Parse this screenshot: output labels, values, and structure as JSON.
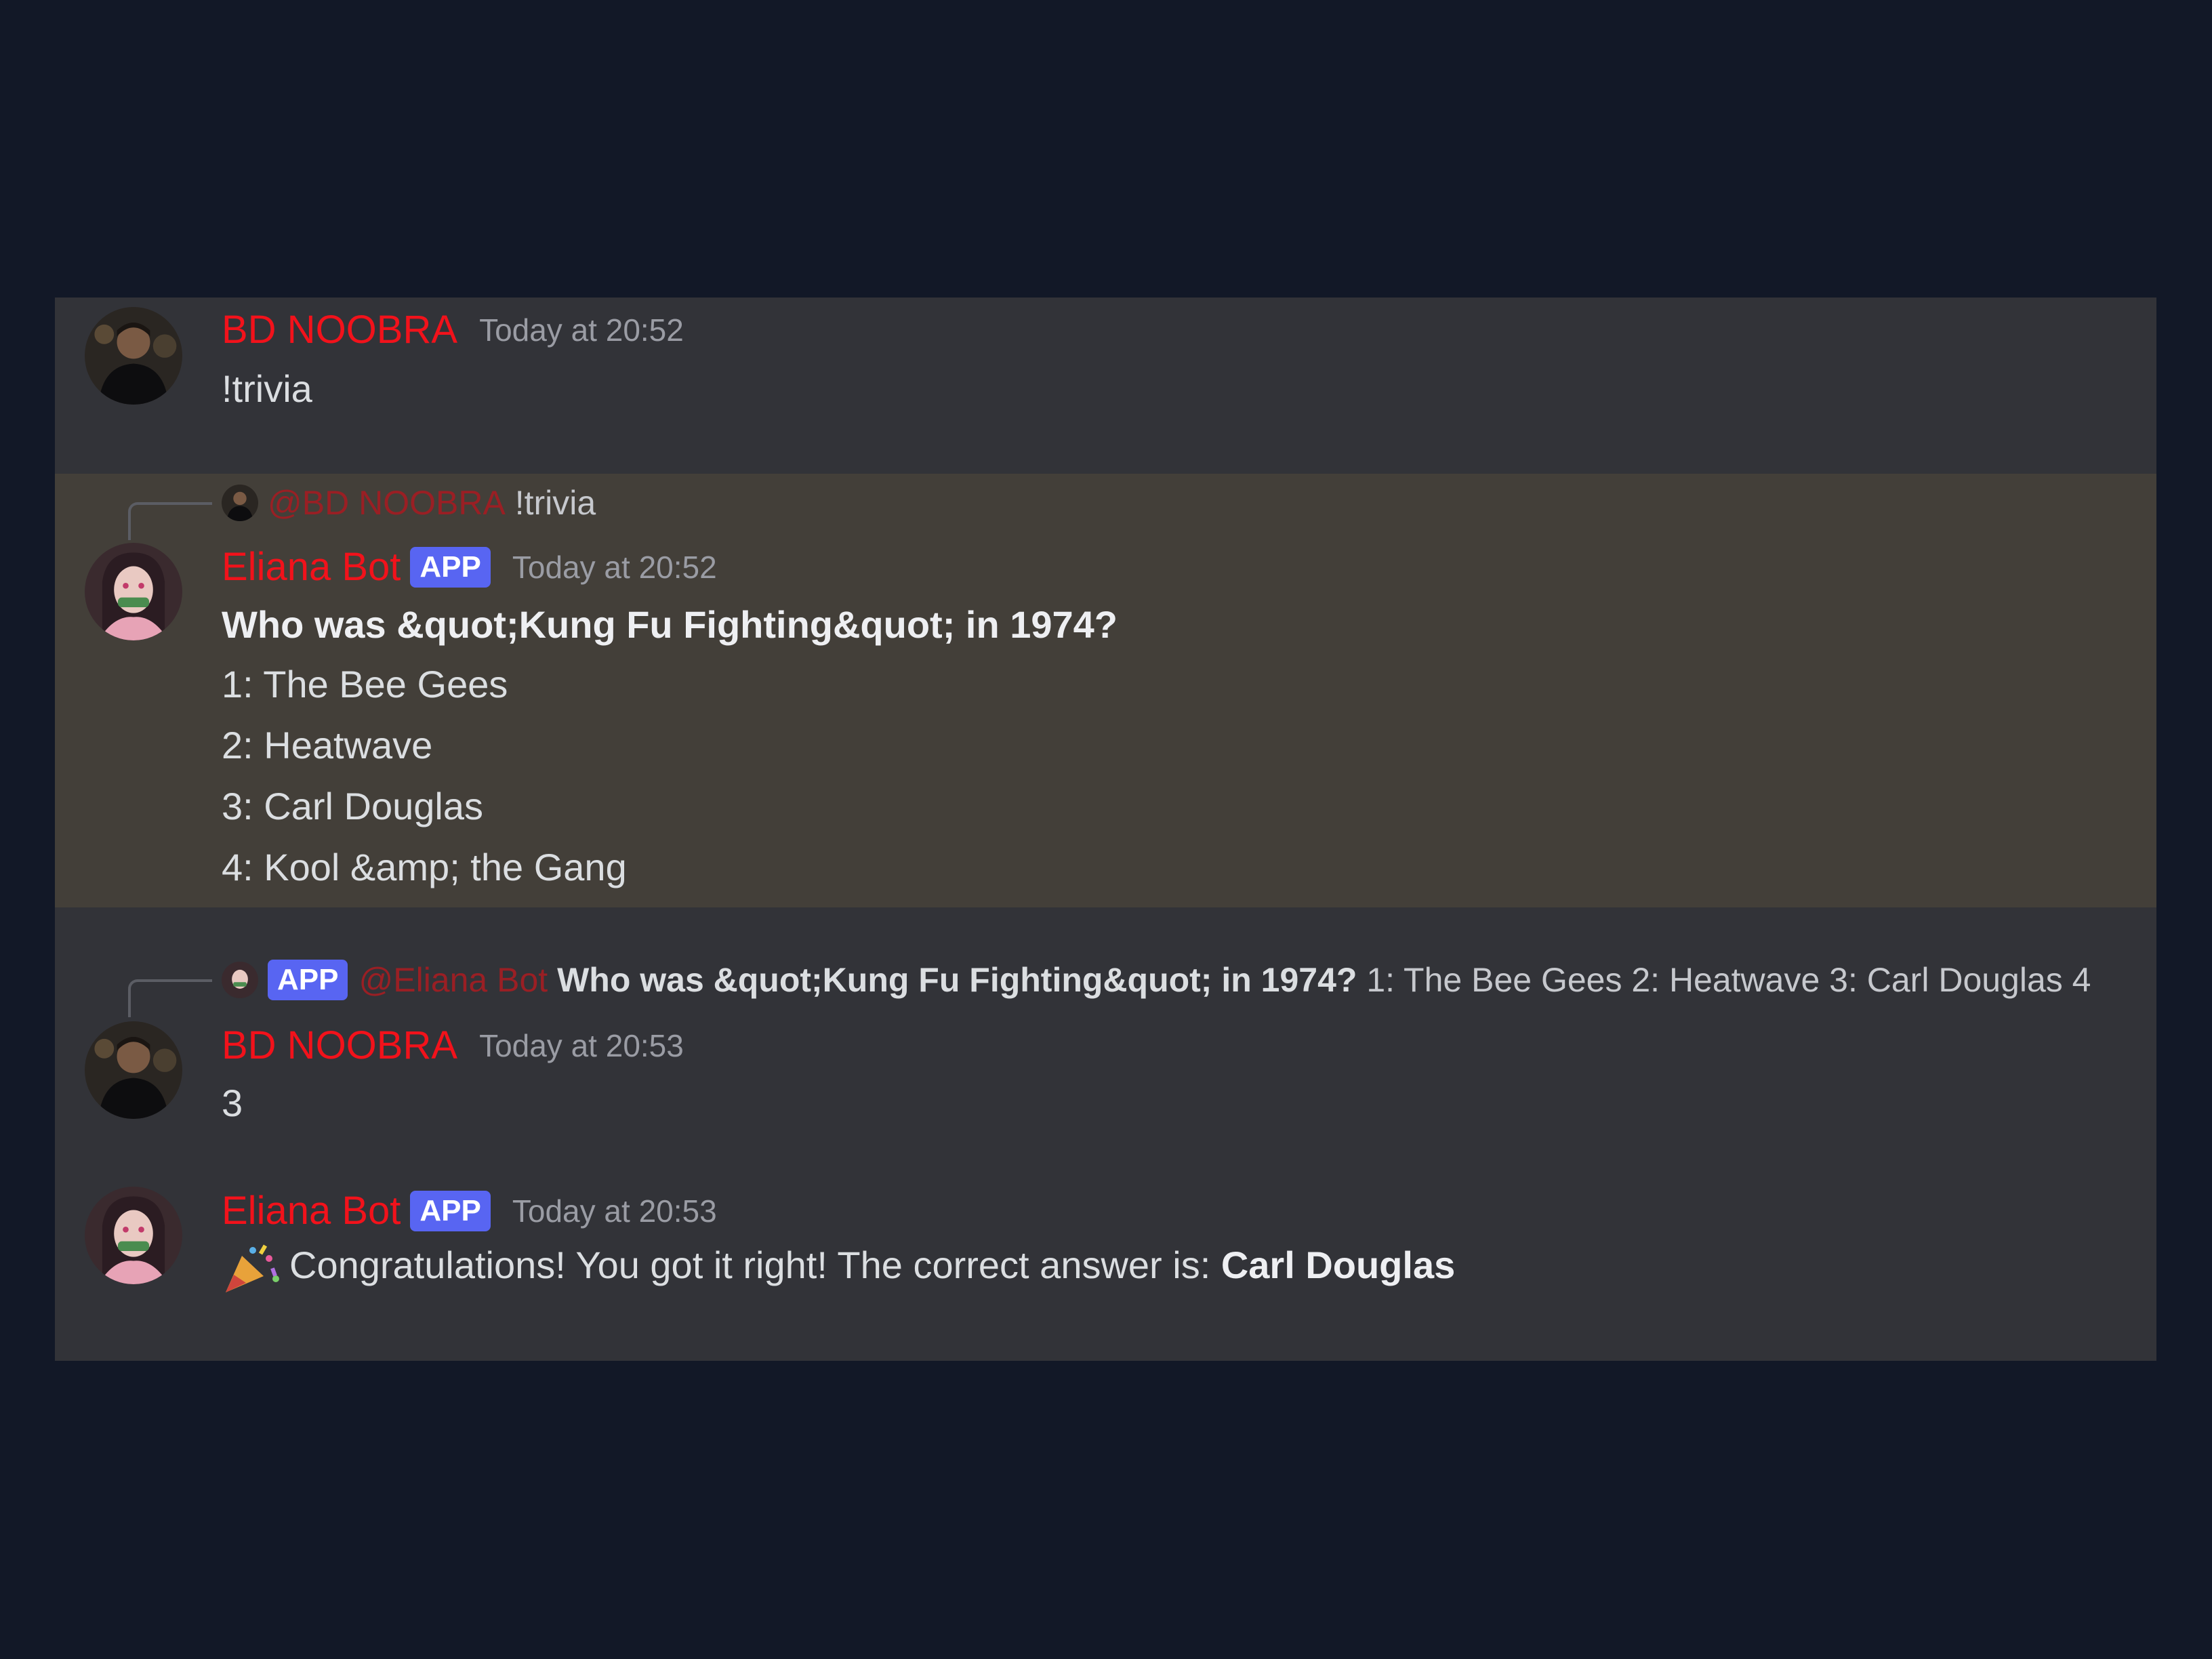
{
  "messages": [
    {
      "author": "BD NOOBRA",
      "timestamp": "Today at 20:52",
      "content": "!trivia"
    },
    {
      "reply": {
        "mention": "@BD NOOBRA",
        "text": "!trivia"
      },
      "author": "Eliana Bot",
      "badge": "APP",
      "timestamp": "Today at 20:52",
      "question": "Who was &quot;Kung Fu Fighting&quot; in 1974?",
      "options": [
        "1: The Bee Gees",
        "2: Heatwave",
        "3: Carl Douglas",
        "4: Kool &amp; the Gang"
      ]
    },
    {
      "reply": {
        "badge": "APP",
        "mention": "@Eliana Bot",
        "bold_text": "Who was &quot;Kung Fu Fighting&quot; in 1974?",
        "text": "1: The Bee Gees 2: Heatwave 3: Carl Douglas 4"
      },
      "author": "BD NOOBRA",
      "timestamp": "Today at 20:53",
      "content": "3"
    },
    {
      "author": "Eliana Bot",
      "badge": "APP",
      "timestamp": "Today at 20:53",
      "emoji": "party-popper",
      "content": "Congratulations! You got it right! The correct answer is: ",
      "answer": "Carl Douglas"
    }
  ],
  "colors": {
    "page_background": "#121827",
    "chat_background": "#323338",
    "highlight_background": "#433f39",
    "username": "#f2121b",
    "app_badge": "#5865f2"
  }
}
